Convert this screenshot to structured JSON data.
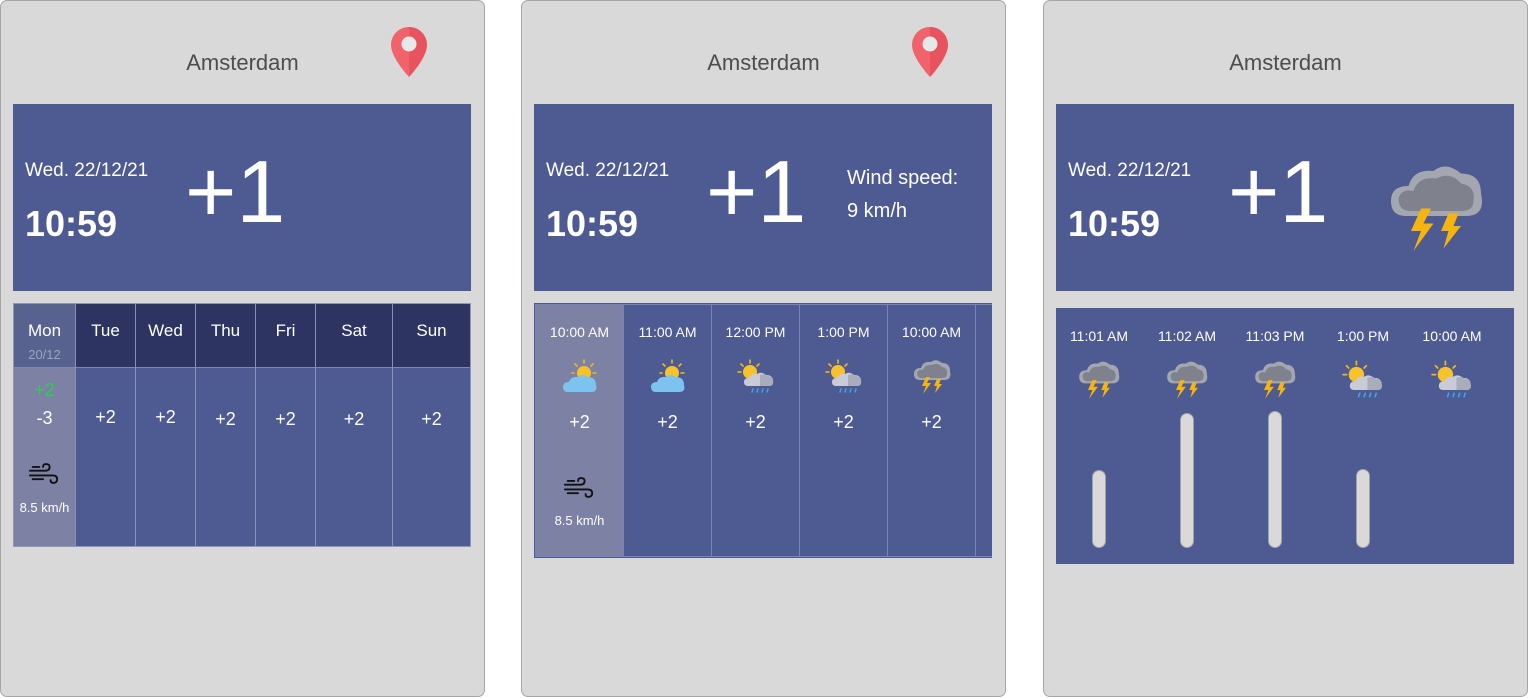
{
  "city": "Amsterdam",
  "date": "Wed. 22/12/21",
  "time": "10:59",
  "temperature": "+1",
  "wind_label": "Wind speed:",
  "wind_value": "9 km/h",
  "weekly": [
    {
      "day": "Mon",
      "date": "20/12",
      "high": "+2",
      "low": "-3",
      "wind": "8.5 km/h",
      "selected": true
    },
    {
      "day": "Tue",
      "temp": "+2"
    },
    {
      "day": "Wed",
      "temp": "+2"
    },
    {
      "day": "Thu",
      "temp": "+2"
    },
    {
      "day": "Fri",
      "temp": "+2"
    },
    {
      "day": "Sat",
      "temp": "+2"
    },
    {
      "day": "Sun",
      "temp": "+2"
    }
  ],
  "hourly": [
    {
      "time": "10:00 AM",
      "temp": "+2",
      "icon": "partly-cloudy-icon",
      "wind": "8.5 km/h",
      "selected": true
    },
    {
      "time": "11:00 AM",
      "temp": "+2",
      "icon": "partly-cloudy-icon"
    },
    {
      "time": "12:00 PM",
      "temp": "+2",
      "icon": "sun-rain-icon"
    },
    {
      "time": "1:00 PM",
      "temp": "+2",
      "icon": "sun-rain-icon"
    },
    {
      "time": "10:00 AM",
      "temp": "+2",
      "icon": "thunderstorm-icon"
    }
  ],
  "intervals": [
    {
      "time": "11:01 AM",
      "icon": "thunderstorm-icon",
      "level": 0.47
    },
    {
      "time": "11:02 AM",
      "icon": "thunderstorm-icon",
      "level": 0.82
    },
    {
      "time": "11:03 PM",
      "icon": "thunderstorm-icon",
      "level": 0.83
    },
    {
      "time": "1:00 PM",
      "icon": "sun-rain-icon",
      "level": 0.48
    },
    {
      "time": "10:00 AM",
      "icon": "sun-rain-icon",
      "level": 0
    }
  ],
  "colors": {
    "panel": "#d9d9d9",
    "header": "#4e5a92",
    "day_header": "#2d3461",
    "selected": "#7d82a5",
    "pin": "#f0636b",
    "green": "#29d24b"
  }
}
